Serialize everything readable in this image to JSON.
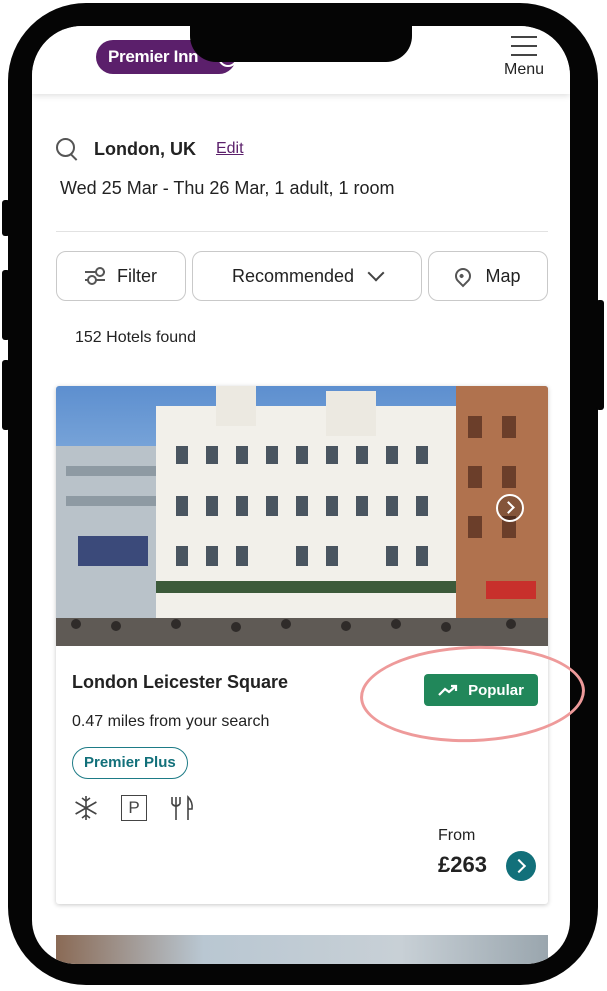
{
  "header": {
    "logo_text": "Premier Inn",
    "menu_label": "Menu"
  },
  "search": {
    "location": "London, UK",
    "edit_label": "Edit",
    "dates": "Wed 25 Mar - Thu 26 Mar, 1 adult, 1 room"
  },
  "controls": {
    "filter_label": "Filter",
    "sort_label": "Recommended",
    "map_label": "Map"
  },
  "results": {
    "count_text": "152 Hotels found"
  },
  "hotel": {
    "name": "London Leicester Square",
    "badge": "Popular",
    "distance": "0.47 miles from your search",
    "tier": "Premier Plus",
    "amenity_icons": [
      "snowflake-icon",
      "parking-icon",
      "restaurant-icon"
    ],
    "parking_symbol": "P",
    "from_label": "From",
    "price": "£263"
  },
  "colors": {
    "brand": "#5b1f6b",
    "popular_badge": "#21875a",
    "teal": "#12707a",
    "highlight": "#ee9a9a"
  }
}
